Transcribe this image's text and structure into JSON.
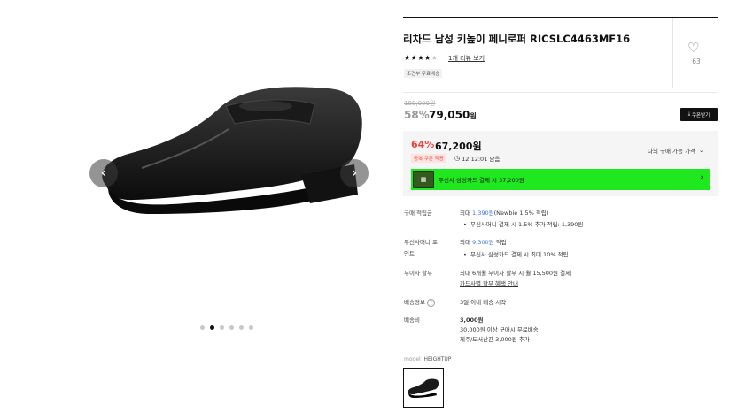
{
  "product": {
    "title": "리차드 남성 키높이 페니로퍼 RICSLC4463MF16",
    "stars_filled": "★★★★",
    "stars_empty": "★",
    "review_link": "1개 리뷰 보기",
    "tag": "조건부 무료배송",
    "like_count": "63"
  },
  "pricing": {
    "original_price": "188,000원",
    "discount_rate": "58%",
    "sale_price": "79,050",
    "currency": "원",
    "coupon_button": "쿠폰받기",
    "best_rate": "64%",
    "best_price": "67,200원",
    "badge": "중복 쿠폰 적용",
    "timer": "12:12:01 남음",
    "my_price_label": "나의 구매 가능 가격",
    "promo_text": "무신사 삼성카드 결제 시 37,200원"
  },
  "info": {
    "points_label": "구매 적립금",
    "points_prefix": "최대 ",
    "points_amount": "1,390원",
    "points_suffix": "(Newbie 1.5% 적립)",
    "points_bullet": "무신사머니 결제 시 1.5% 추가 적립: 1,390원",
    "money_label": "무신사머니 포인트",
    "money_prefix": "최대 ",
    "money_amount": "9,300원",
    "money_suffix": " 적립",
    "money_bullet": "무신사 삼성카드 결제 시 최대 10% 적립",
    "installment_label": "무이자 할부",
    "installment_text": "최대 6개월 무이자 할부 시 월 15,500원 결제",
    "installment_link": "카드사별 할부 혜택 안내",
    "shipping_info_label": "배송정보",
    "shipping_info_text": "3일 이내 배송 시작",
    "shipping_fee_label": "배송비",
    "shipping_fee": "3,000원",
    "shipping_free": "30,000원 이상 구매시 무료배송",
    "shipping_island": "제주/도서산간 3,000원 추가"
  },
  "model": {
    "label": "model",
    "name": "HEIGHTUP"
  },
  "gallery": {
    "total_dots": 6,
    "active_dot": 2
  },
  "icons": {
    "heart": "heart-icon",
    "chevron_left": "chevron-left-icon",
    "chevron_right": "chevron-right-icon",
    "clock": "clock-icon",
    "chevron_down": "chevron-down-icon",
    "download": "download-icon"
  },
  "colors": {
    "sale_red": "#f0433b",
    "promo_green": "#1fe81f",
    "link_blue": "#3c6fe0"
  }
}
